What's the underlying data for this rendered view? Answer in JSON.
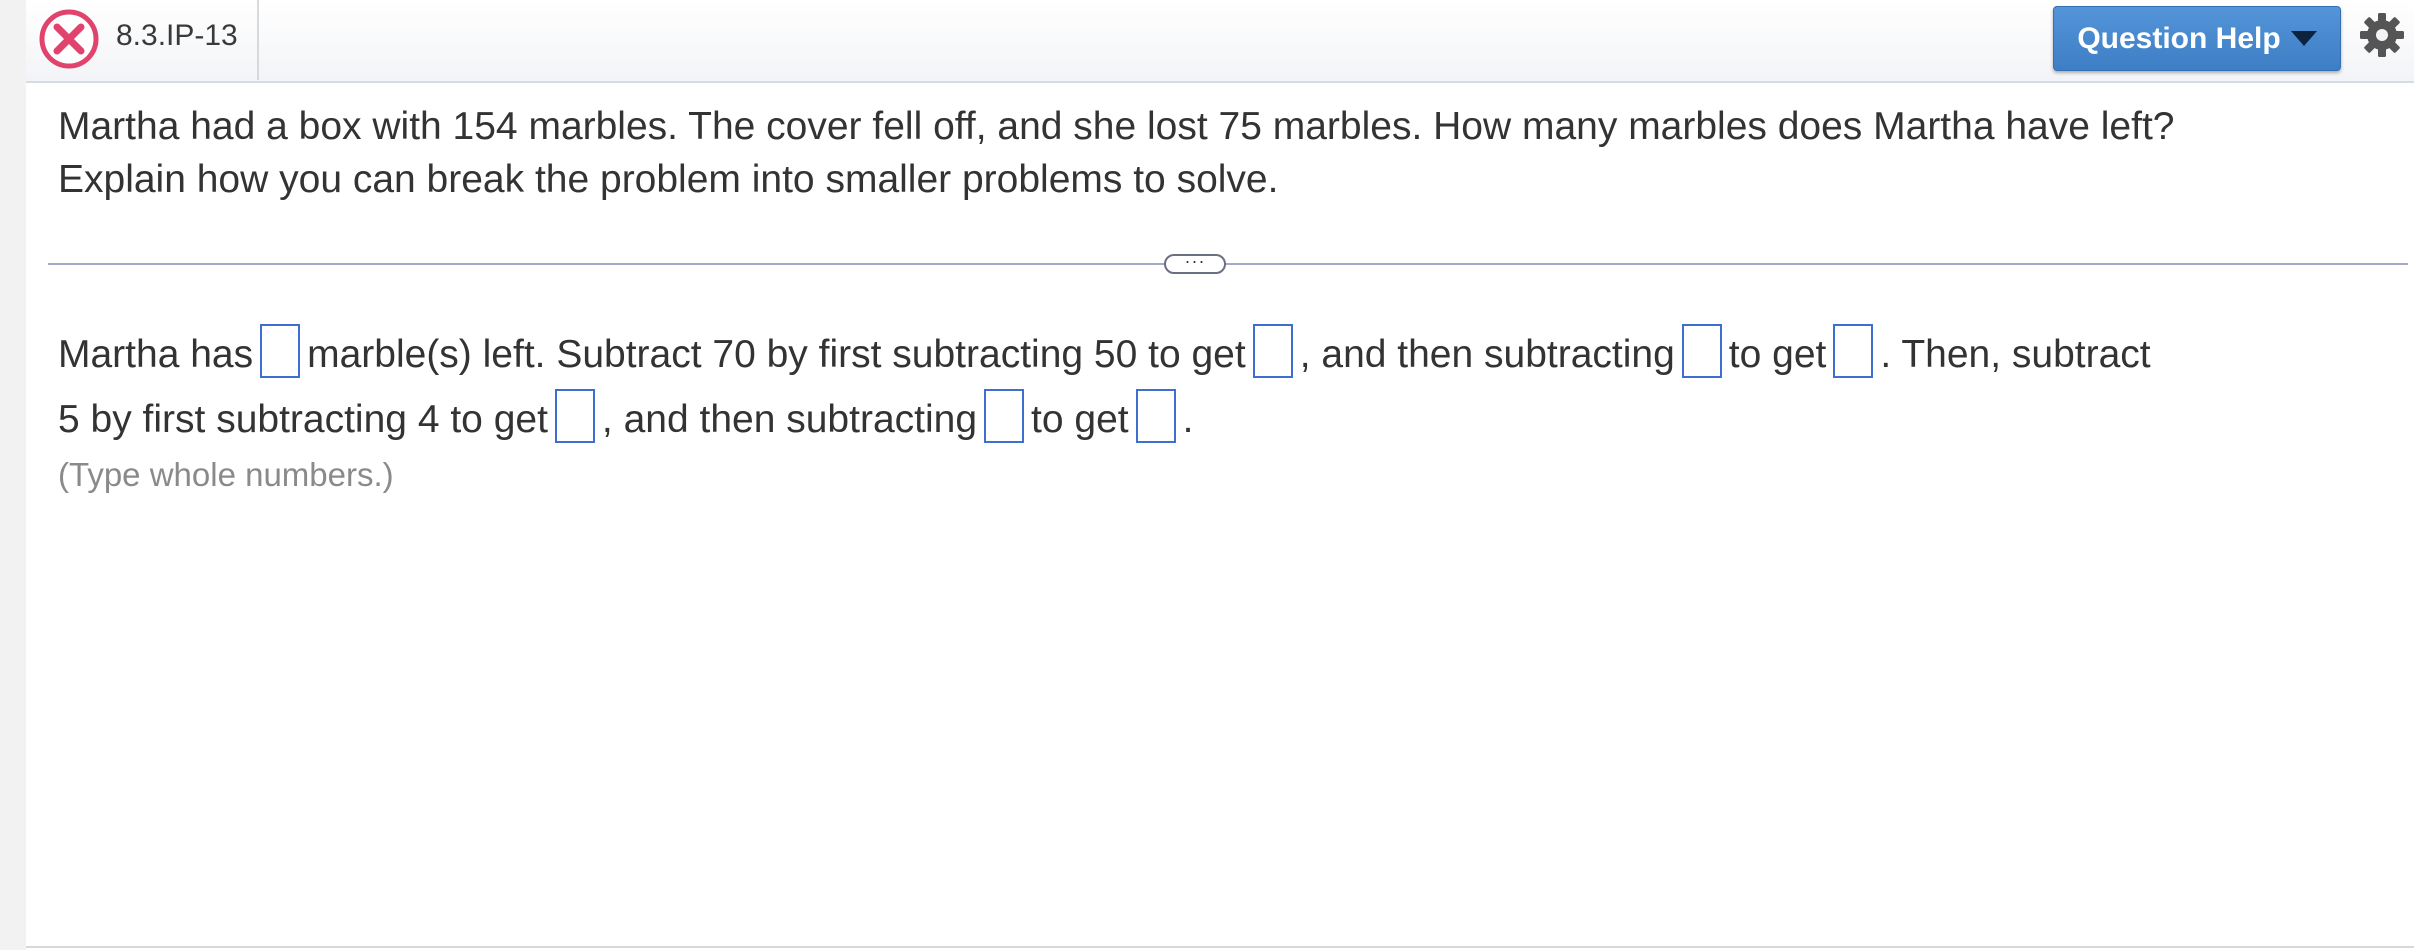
{
  "header": {
    "question_id": "8.3.IP-13",
    "help_button_label": "Question Help",
    "status_icon": "incorrect-x-icon",
    "settings_icon": "gear-icon"
  },
  "question": {
    "line1": "Martha had a box with 154 marbles. The cover fell off, and she lost 75 marbles. How many marbles does Martha have left?",
    "line2": "Explain how you can break the problem into smaller problems to solve."
  },
  "answer": {
    "seg1": "Martha has",
    "seg2": "marble(s) left. Subtract 70 by first subtracting 50 to get",
    "seg3": ", and then subtracting",
    "seg4": "to get",
    "seg5": ". Then, subtract",
    "seg6": "5 by first subtracting 4 to get",
    "seg7": ", and then subtracting",
    "seg8": "to get",
    "seg9": ".",
    "hint": "(Type whole numbers.)"
  },
  "colors": {
    "accent_blue": "#4a89d0",
    "error_red": "#e0436c",
    "input_border": "#3c6fcf",
    "divider": "#a3a9c9"
  }
}
